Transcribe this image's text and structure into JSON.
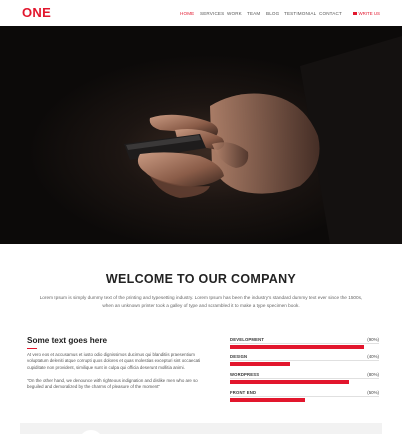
{
  "brand": {
    "logo": "ONE",
    "accent": "#e2162d"
  },
  "nav": {
    "items": [
      {
        "label": "HOME",
        "active": true
      },
      {
        "label": "SERVICES",
        "active": false
      },
      {
        "label": "WORK",
        "active": false
      },
      {
        "label": "TEAM",
        "active": false
      },
      {
        "label": "BLOG",
        "active": false
      },
      {
        "label": "TESTIMONIAL",
        "active": false
      },
      {
        "label": "CONTACT",
        "active": false
      }
    ],
    "write_us": "WRITE US",
    "write_us_icon": "envelope-icon"
  },
  "hero": {
    "image": "hands-holding-smartphone-dark"
  },
  "welcome": {
    "title": "WELCOME TO OUR COMPANY",
    "text": "Lorem Ipsum is simply dummy text of the printing and typesetting industry. Lorem Ipsum has been the industry's standard dummy text ever since the 1500s, when an unknown printer took a galley of type and scrambled it to make a type specimen book."
  },
  "about": {
    "title": "Some text goes here",
    "para1": "At vero eos et accusamus et iusto odio dignissimos ducimus qui blanditiis praesentium voluptatum deleniti atque corrupti quos dolores et quas molestias excepturi sint occaecati cupiditate non provident, similique sunt in culpa qui officia deserunt mollitia animi.",
    "para2": "\"On the other hand, we denounce with righteous indignation and dislike men who are so beguiled and demoralized by the charms of pleasure of the moment\""
  },
  "skills": [
    {
      "name": "DEVELOPMENT",
      "percent_label": "(90%)",
      "value": 90
    },
    {
      "name": "DESIGN",
      "percent_label": "(40%)",
      "value": 40
    },
    {
      "name": "WORDPRESS",
      "percent_label": "(80%)",
      "value": 80
    },
    {
      "name": "FRONT END",
      "percent_label": "(50%)",
      "value": 50
    }
  ]
}
